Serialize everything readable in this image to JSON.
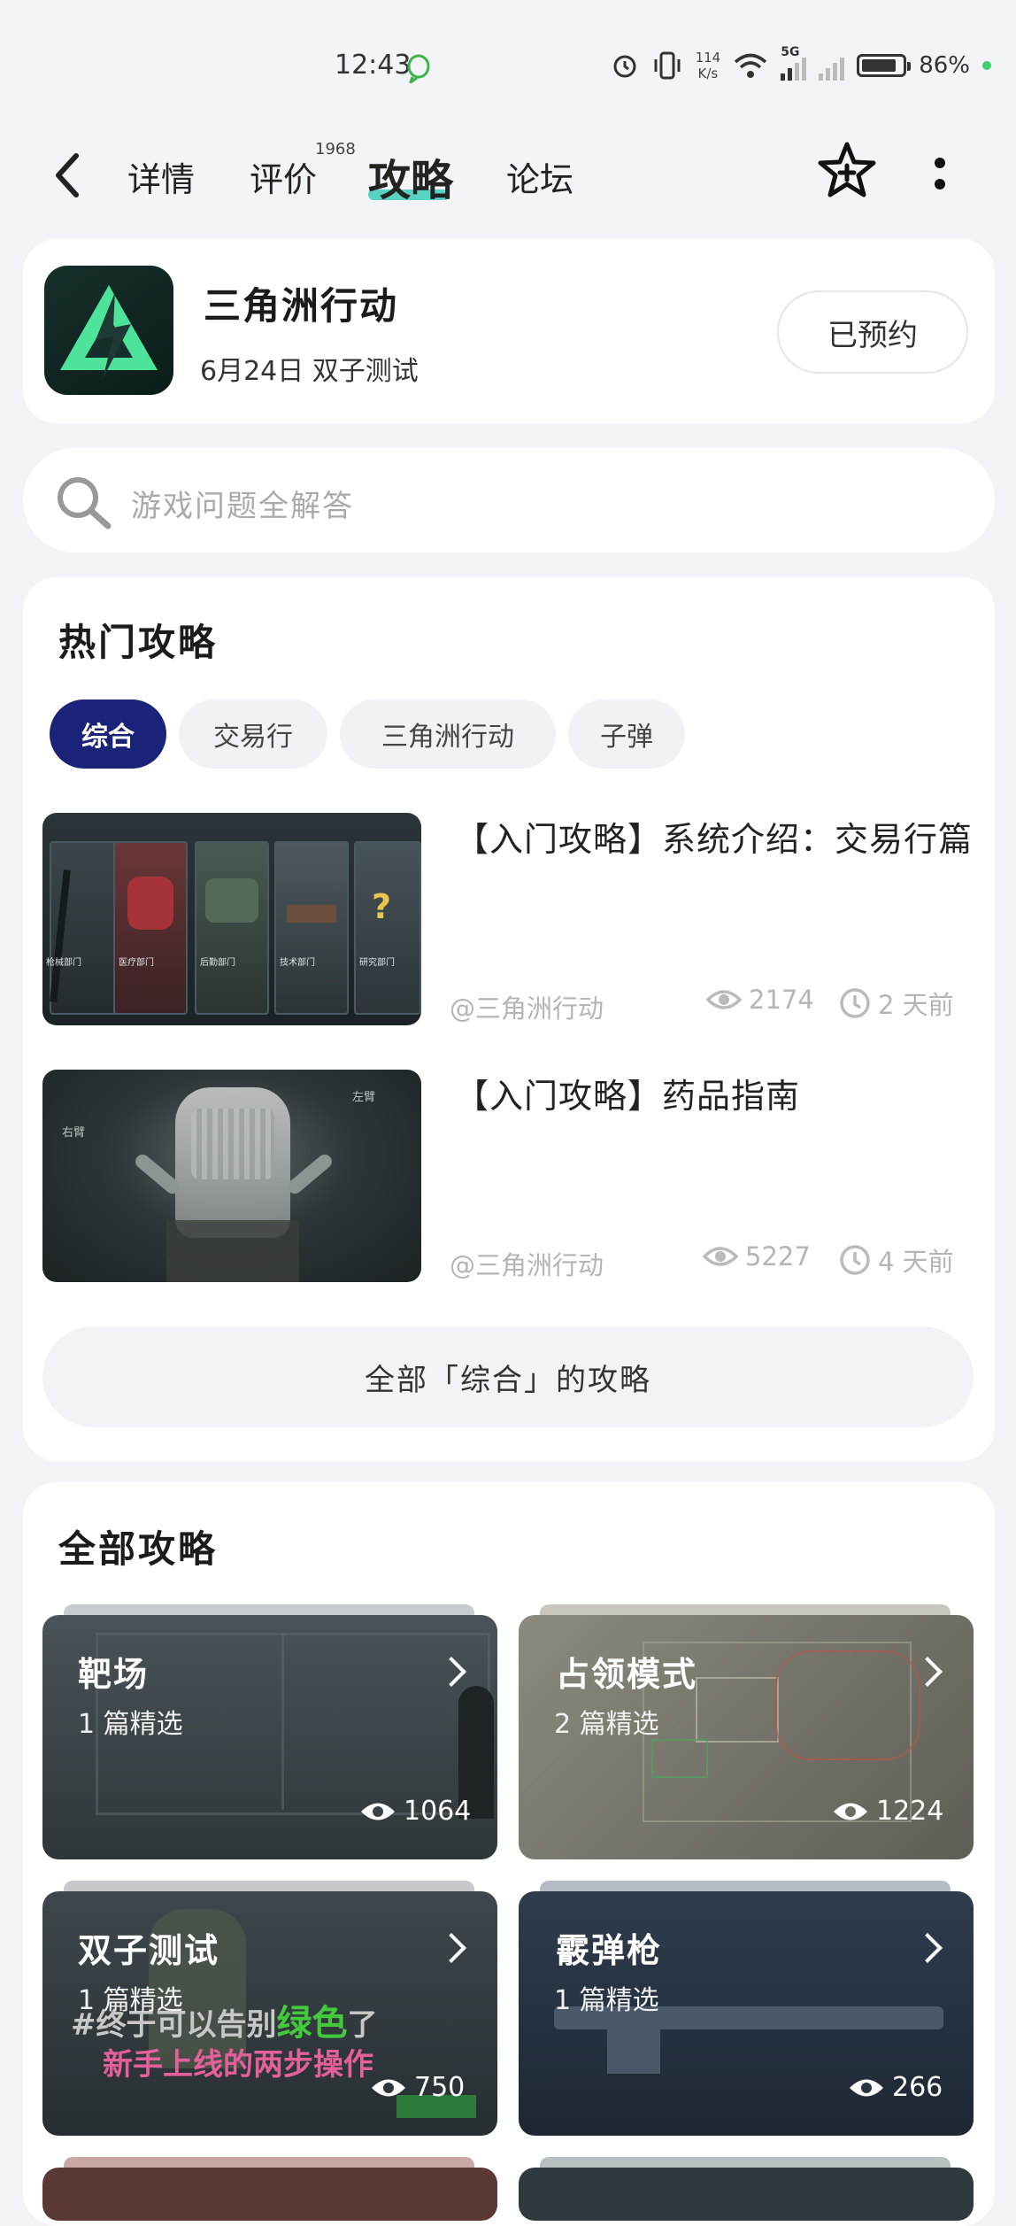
{
  "status_bar": {
    "time": "12:43",
    "net_speed_value": "114",
    "net_speed_unit": "K/s",
    "signal_label": "5G",
    "battery": "86%"
  },
  "nav": {
    "tabs": [
      {
        "label": "详情",
        "active": false
      },
      {
        "label": "评价",
        "active": false,
        "badge": "1968"
      },
      {
        "label": "攻略",
        "active": true
      },
      {
        "label": "论坛",
        "active": false
      }
    ]
  },
  "game": {
    "name": "三角洲行动",
    "subtitle": "6月24日  双子测试",
    "reserve_label": "已预约"
  },
  "search": {
    "placeholder": "游戏问题全解答"
  },
  "hot": {
    "title": "热门攻略",
    "chips": [
      {
        "label": "综合",
        "active": true
      },
      {
        "label": "交易行",
        "active": false
      },
      {
        "label": "三角洲行动",
        "active": false
      },
      {
        "label": "子弹",
        "active": false
      }
    ],
    "articles": [
      {
        "title": "【入门攻略】系统介绍：交易行篇",
        "author": "@三角洲行动",
        "views": "2174",
        "time": "2 天前",
        "thumb_labels": [
          "枪械部门",
          "医疗部门",
          "后勤部门",
          "技术部门",
          "研究部门"
        ]
      },
      {
        "title": "【入门攻略】药品指南",
        "author": "@三角洲行动",
        "views": "5227",
        "time": "4 天前",
        "thumb_labels": [
          "右臂",
          "左臂"
        ]
      }
    ],
    "all_button": "全部「综合」的攻略"
  },
  "all": {
    "title": "全部攻略",
    "tiles": [
      {
        "name": "靶场",
        "count": "1 篇精选",
        "views": "1064"
      },
      {
        "name": "占领模式",
        "count": "2 篇精选",
        "views": "1224"
      },
      {
        "name": "双子测试",
        "count": "1 篇精选",
        "views": "750",
        "overlay_line1_a": "#终于可以告别",
        "overlay_line1_b": "绿色",
        "overlay_line1_c": "了",
        "overlay_line2": "新手上线的两步操作"
      },
      {
        "name": "霰弹枪",
        "count": "1 篇精选",
        "views": "266"
      }
    ]
  },
  "colors": {
    "accent_teal": "#58d3c2",
    "chip_active": "#1b2378",
    "overlay_green": "#44c83c",
    "overlay_pink": "#e4609a"
  }
}
